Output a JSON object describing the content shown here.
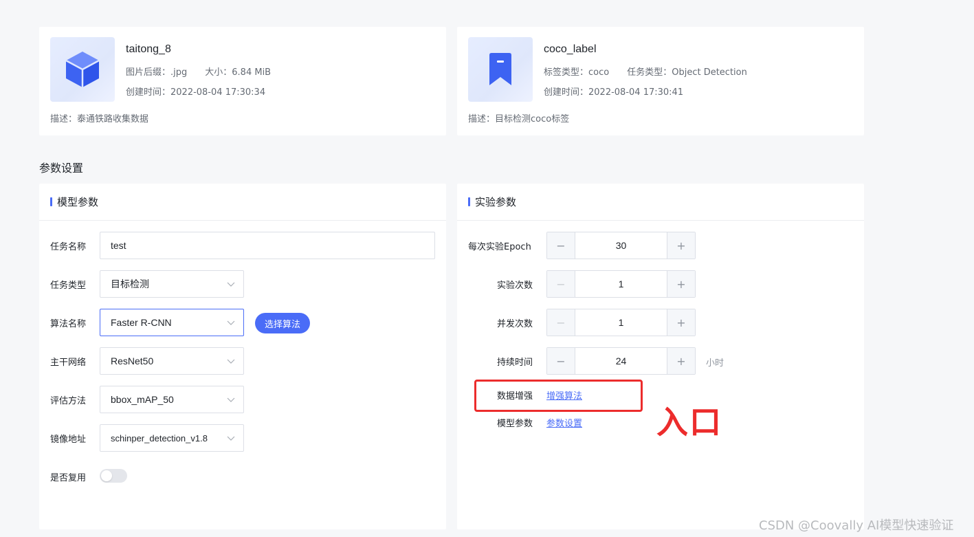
{
  "datasets": [
    {
      "name": "taitong_8",
      "suffix_label": "图片后缀：",
      "suffix": ".jpg",
      "size_label": "大小：",
      "size": "6.84 MiB",
      "created_label": "创建时间：",
      "created": "2022-08-04 17:30:34",
      "desc_label": "描述：",
      "desc": "泰通铁路收集数据",
      "icon": "cube-icon"
    },
    {
      "name": "coco_label",
      "label_type_label": "标签类型：",
      "label_type": "coco",
      "task_type_label": "任务类型：",
      "task_type": "Object Detection",
      "created_label": "创建时间：",
      "created": "2022-08-04 17:30:41",
      "desc_label": "描述：",
      "desc": "目标检测coco标签",
      "icon": "bookmark-icon"
    }
  ],
  "section_title": "参数设置",
  "model_params": {
    "title": "模型参数",
    "task_name_label": "任务名称",
    "task_name": "test",
    "task_type_label": "任务类型",
    "task_type": "目标检测",
    "algo_label": "算法名称",
    "algo": "Faster R-CNN",
    "select_algo_button": "选择算法",
    "backbone_label": "主干网络",
    "backbone": "ResNet50",
    "eval_label": "评估方法",
    "eval": "bbox_mAP_50",
    "image_label": "镜像地址",
    "image": "schinper_detection_v1.8",
    "reuse_label": "是否复用",
    "reuse_enabled": false
  },
  "exp_params": {
    "title": "实验参数",
    "epoch_label": "每次实验Epoch",
    "epoch": "30",
    "runs_label": "实验次数",
    "runs": "1",
    "concurrency_label": "并发次数",
    "concurrency": "1",
    "duration_label": "持续时间",
    "duration": "24",
    "duration_unit": "小时",
    "augment_label": "数据增强",
    "augment_link": "增强算法",
    "model_param_label": "模型参数",
    "model_param_link": "参数设置"
  },
  "annotation_text": "入口",
  "watermark": "CSDN @Coovally   AI模型快速验证",
  "colors": {
    "accent": "#4a6cf7",
    "annotation": "#ec2c2c"
  }
}
